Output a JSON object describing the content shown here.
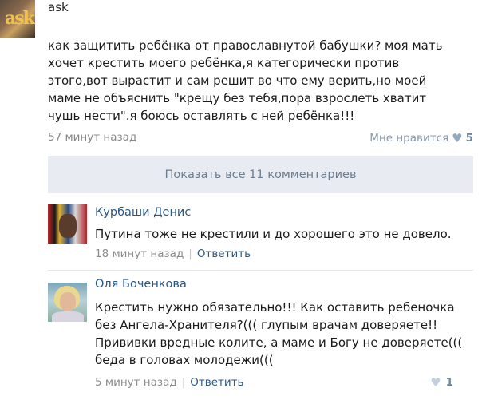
{
  "post": {
    "author": "ask",
    "avatar_text": "ask",
    "text_lines": [
      "как защитить ребёнка от православнутой бабушки? моя мать",
      "хочет крестить моего ребёнка,я категорически против",
      "этого,вот вырастит и сам решит во что ему верить,но моей",
      "маме не объяснить \"крещу без тебя,пора взрослеть хватит",
      "чушь нести\".я боюсь оставлять с ней ребёнка!!!"
    ],
    "time": "57 минут назад",
    "like_label": "Мне нравится",
    "like_icon": "heart-icon",
    "like_count": "5"
  },
  "show_all": {
    "label": "Показать все 11 комментариев"
  },
  "comments": [
    {
      "name": "Курбаши Денис",
      "text_lines": [
        "Путина тоже не крестили и до хорошего это не довело."
      ],
      "time": "18 минут назад",
      "reply": "Ответить"
    },
    {
      "name": "Оля Боченкова",
      "text_lines": [
        "Крестить нужно обязательно!!! Как оставить ребеночка",
        "без Ангела-Хранителя?((( глупым врачам доверяете!!",
        "Прививки вредные колите, а маме и Богу не доверяете(((",
        "беда в головах молодежи((("
      ],
      "time": "5 минут назад",
      "reply": "Ответить",
      "like_count": "1"
    }
  ],
  "separator": "|"
}
